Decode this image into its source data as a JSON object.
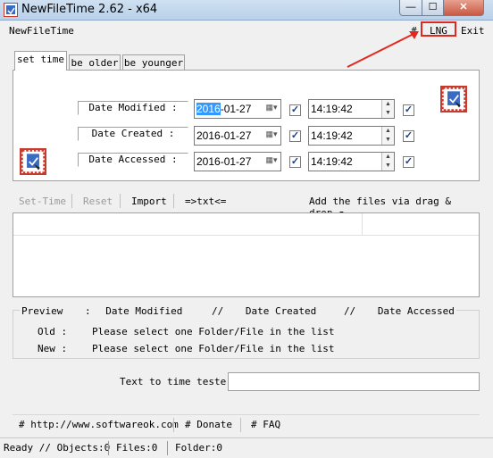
{
  "window": {
    "title": "NewFileTime 2.62 - x64",
    "minimize_label": "—",
    "maximize_label": "☐",
    "close_label": "✕"
  },
  "menu": {
    "app": "NewFileTime",
    "hash": "#",
    "lng": "LNG",
    "exit": "Exit"
  },
  "tabs": [
    {
      "label": "set time",
      "active": true
    },
    {
      "label": "be older",
      "active": false
    },
    {
      "label": "be younger",
      "active": false
    }
  ],
  "dates": [
    {
      "label": "Date Modified :",
      "date_selected": "2016",
      "date_rest": "-01-27",
      "time": "14:19:42",
      "checked": true
    },
    {
      "label": "Date Created :",
      "date": "2016-01-27",
      "time": "14:19:42",
      "checked": true
    },
    {
      "label": "Date Accessed :",
      "date": "2016-01-27",
      "time": "14:19:42",
      "checked": true
    }
  ],
  "toolbar": {
    "set_time": "Set-Time",
    "reset": "Reset",
    "import": "Import",
    "txt": "=>txt<=",
    "add_files": "Add the files via drag & drop"
  },
  "preview": {
    "header_preview": "Preview",
    "header_sep1": ":",
    "header_modified": "Date Modified",
    "header_sep2": "//",
    "header_created": "Date Created",
    "header_sep3": "//",
    "header_accessed": "Date Accessed",
    "old_label": "Old :",
    "old_text": "Please select one Folder/File in the list",
    "new_label": "New :",
    "new_text": "Please select one Folder/File in the list"
  },
  "tester": {
    "label": "Text to time tester",
    "value": ""
  },
  "links": {
    "site": "# http://www.softwareok.com",
    "donate": "# Donate",
    "faq": "# FAQ"
  },
  "status": {
    "ready": "Ready // Objects:0",
    "files": "Files:0",
    "folder": "Folder:0"
  },
  "colors": {
    "accent_red": "#e0281e",
    "selection": "#3399ff"
  }
}
